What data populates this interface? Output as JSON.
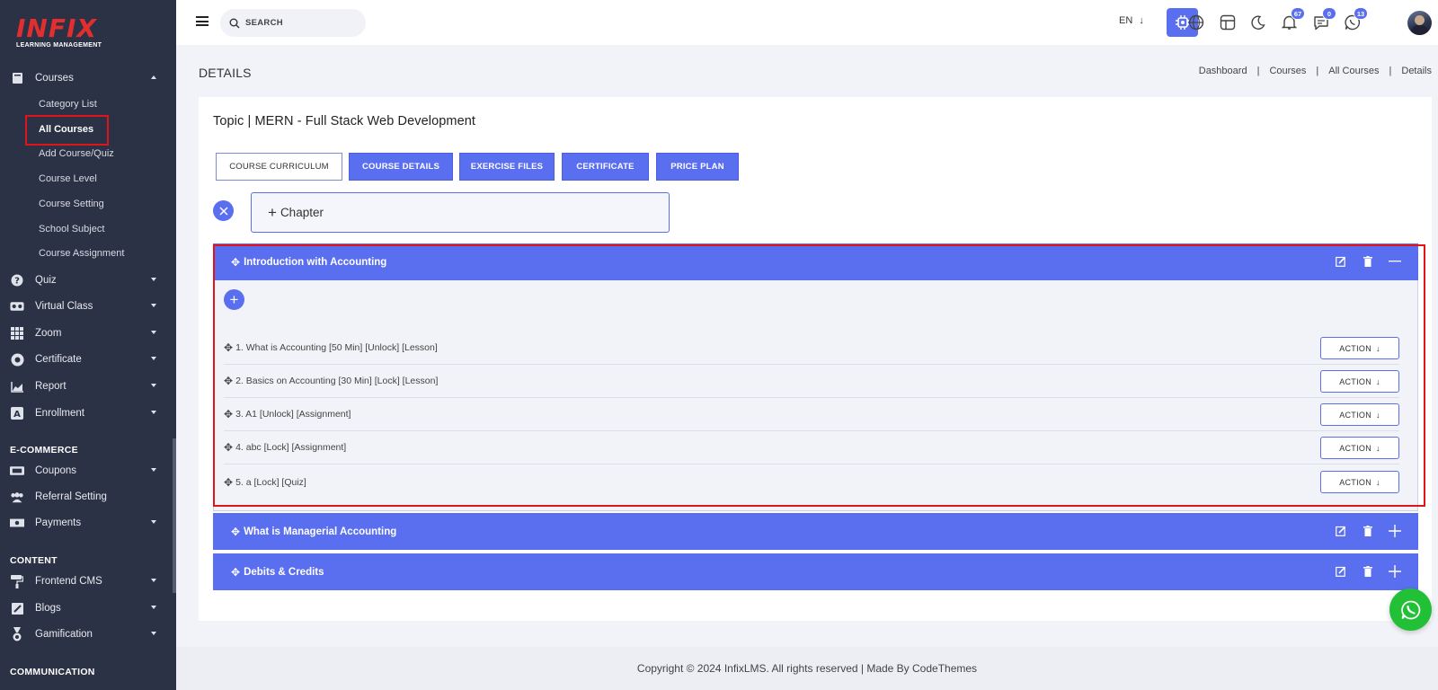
{
  "logo": {
    "text": "INFIX",
    "subtitle": "LEARNING MANAGEMENT"
  },
  "sidebar": {
    "courses": {
      "label": "Courses",
      "items": [
        "Category List",
        "All Courses",
        "Add Course/Quiz",
        "Course Level",
        "Course Setting",
        "School Subject",
        "Course Assignment"
      ]
    },
    "nav": [
      {
        "label": "Quiz",
        "icon": "question-circle-icon"
      },
      {
        "label": "Virtual Class",
        "icon": "vr-headset-icon"
      },
      {
        "label": "Zoom",
        "icon": "grid-icon"
      },
      {
        "label": "Certificate",
        "icon": "certificate-icon"
      },
      {
        "label": "Report",
        "icon": "area-chart-icon"
      },
      {
        "label": "Enrollment",
        "icon": "enrollment-icon"
      }
    ],
    "ecommerce_label": "E-COMMERCE",
    "ecommerce": [
      {
        "label": "Coupons",
        "icon": "ticket-icon"
      },
      {
        "label": "Referral Setting",
        "icon": "users-icon"
      },
      {
        "label": "Payments",
        "icon": "money-icon"
      }
    ],
    "content_label": "CONTENT",
    "content": [
      {
        "label": "Frontend CMS",
        "icon": "paint-roller-icon"
      },
      {
        "label": "Blogs",
        "icon": "edit-square-icon"
      },
      {
        "label": "Gamification",
        "icon": "medal-icon"
      }
    ],
    "communication_label": "COMMUNICATION"
  },
  "header": {
    "search_placeholder": "SEARCH",
    "language": "EN",
    "badges": {
      "notifications": "67",
      "messages": "0",
      "whatsapp": "13"
    }
  },
  "page": {
    "title": "DETAILS",
    "breadcrumb": [
      "Dashboard",
      "Courses",
      "All Courses",
      "Details"
    ]
  },
  "course": {
    "topic_title": "Topic | MERN - Full Stack Web Development",
    "tabs": [
      "COURSE CURRICULUM",
      "COURSE DETAILS",
      "EXERCISE FILES",
      "CERTIFICATE",
      "PRICE PLAN"
    ],
    "chapter_placeholder": "Chapter",
    "chapters": [
      {
        "title": "Introduction with Accounting",
        "lessons": [
          "1. What is Accounting [50 Min] [Unlock] [Lesson]",
          "2. Basics on Accounting [30 Min] [Lock] [Lesson]",
          "3. A1 [Unlock] [Assignment]",
          "4. abc [Lock] [Assignment]",
          "5. a [Lock] [Quiz]"
        ],
        "action_label": "ACTION"
      },
      {
        "title": "What is Managerial Accounting"
      },
      {
        "title": "Debits & Credits"
      }
    ]
  },
  "footer": {
    "text": "Copyright © 2024 InfixLMS. All rights reserved | Made By CodeThemes"
  },
  "colors": {
    "primary": "#5a6ef0",
    "sidebar": "#2c3245",
    "highlight": "#e0141b",
    "whatsapp": "#22c036"
  }
}
